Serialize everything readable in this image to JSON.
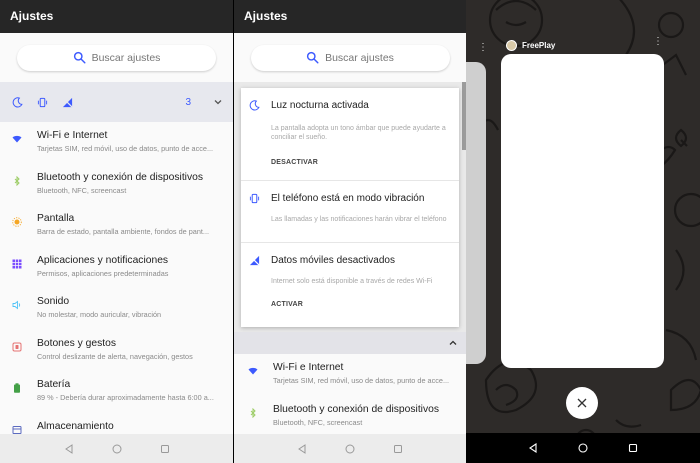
{
  "panel1": {
    "title": "Ajustes",
    "search_placeholder": "Buscar ajustes",
    "quick_settings": {
      "icons": [
        "moon-icon",
        "vibrate-icon",
        "mobile-data-off-icon"
      ],
      "count": "3"
    },
    "items": [
      {
        "icon": "wifi-icon",
        "title": "Wi-Fi e Internet",
        "subtitle": "Tarjetas SIM, red móvil, uso de datos, punto de acce..."
      },
      {
        "icon": "bluetooth-icon",
        "title": "Bluetooth y conexión de dispositivos",
        "subtitle": "Bluetooth, NFC, screencast"
      },
      {
        "icon": "brightness-icon",
        "title": "Pantalla",
        "subtitle": "Barra de estado, pantalla ambiente, fondos de pant..."
      },
      {
        "icon": "apps-icon",
        "title": "Aplicaciones y notificaciones",
        "subtitle": "Permisos, aplicaciones predeterminadas"
      },
      {
        "icon": "sound-icon",
        "title": "Sonido",
        "subtitle": "No molestar, modo auricular, vibración"
      },
      {
        "icon": "gestures-icon",
        "title": "Botones y gestos",
        "subtitle": "Control deslizante de alerta, navegación, gestos"
      },
      {
        "icon": "battery-icon",
        "title": "Batería",
        "subtitle": "89 % - Debería durar aproximadamente hasta 6:00 a..."
      },
      {
        "icon": "storage-icon",
        "title": "Almacenamiento",
        "subtitle": ""
      }
    ]
  },
  "panel2": {
    "title": "Ajustes",
    "search_placeholder": "Buscar ajustes",
    "cards": [
      {
        "icon": "moon-icon",
        "title": "Luz nocturna activada",
        "desc": "La pantalla adopta un tono ámbar que puede ayudarte a conciliar el sueño.",
        "action": "DESACTIVAR"
      },
      {
        "icon": "vibrate-icon",
        "title": "El teléfono está en modo vibración",
        "desc": "Las llamadas y las notificaciones harán vibrar el teléfono",
        "action": ""
      },
      {
        "icon": "mobile-data-off-icon",
        "title": "Datos móviles desactivados",
        "desc": "Internet solo está disponible a través de redes Wi-Fi",
        "action": "ACTIVAR"
      }
    ],
    "items": [
      {
        "icon": "wifi-icon",
        "title": "Wi-Fi e Internet",
        "subtitle": "Tarjetas SIM, red móvil, uso de datos, punto de acce..."
      },
      {
        "icon": "bluetooth-icon",
        "title": "Bluetooth y conexión de dispositivos",
        "subtitle": "Bluetooth, NFC, screencast"
      }
    ]
  },
  "panel3": {
    "app_name": "FreePlay"
  },
  "colors": {
    "accent": "#3d5afe",
    "titlebar": "#262626",
    "quickbar": "#e7e8ee",
    "icon_orange": "#f5a623",
    "icon_purple": "#7c4dff",
    "icon_green": "#43a047",
    "icon_pink": "#e57373"
  }
}
